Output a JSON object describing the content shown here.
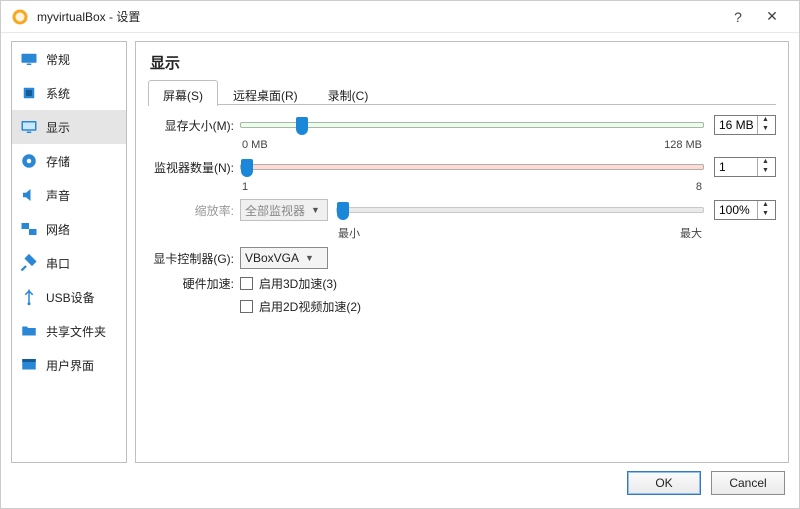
{
  "window": {
    "title": "myvirtualBox - 设置",
    "help_icon": "?",
    "close_icon": "✕"
  },
  "sidebar": {
    "items": [
      {
        "label": "常规",
        "icon": "display"
      },
      {
        "label": "系统",
        "icon": "chip"
      },
      {
        "label": "显示",
        "icon": "monitor",
        "active": true
      },
      {
        "label": "存储",
        "icon": "disk"
      },
      {
        "label": "声音",
        "icon": "speaker"
      },
      {
        "label": "网络",
        "icon": "network"
      },
      {
        "label": "串口",
        "icon": "plug"
      },
      {
        "label": "USB设备",
        "icon": "usb"
      },
      {
        "label": "共享文件夹",
        "icon": "folder"
      },
      {
        "label": "用户界面",
        "icon": "ui"
      }
    ]
  },
  "content": {
    "heading": "显示",
    "tabs": [
      {
        "label": "屏幕(S)",
        "active": true
      },
      {
        "label": "远程桌面(R)"
      },
      {
        "label": "录制(C)"
      }
    ],
    "video_memory": {
      "label": "显存大小(M):",
      "value": "16 MB",
      "min_tick": "0 MB",
      "max_tick": "128 MB",
      "thumb_percent": 12
    },
    "monitor_count": {
      "label": "监视器数量(N):",
      "value": "1",
      "min_tick": "1",
      "max_tick": "8",
      "thumb_percent": 0
    },
    "scale_factor": {
      "label": "缩放率:",
      "monitor_select": "全部监视器",
      "value": "100%",
      "min_tick": "最小",
      "max_tick": "最大",
      "thumb_percent": 0
    },
    "graphics_controller": {
      "label": "显卡控制器(G):",
      "value": "VBoxVGA"
    },
    "hw_accel": {
      "label": "硬件加速:",
      "opt3d": "启用3D加速(3)",
      "opt2d": "启用2D视频加速(2)"
    }
  },
  "footer": {
    "ok": "OK",
    "cancel": "Cancel"
  }
}
